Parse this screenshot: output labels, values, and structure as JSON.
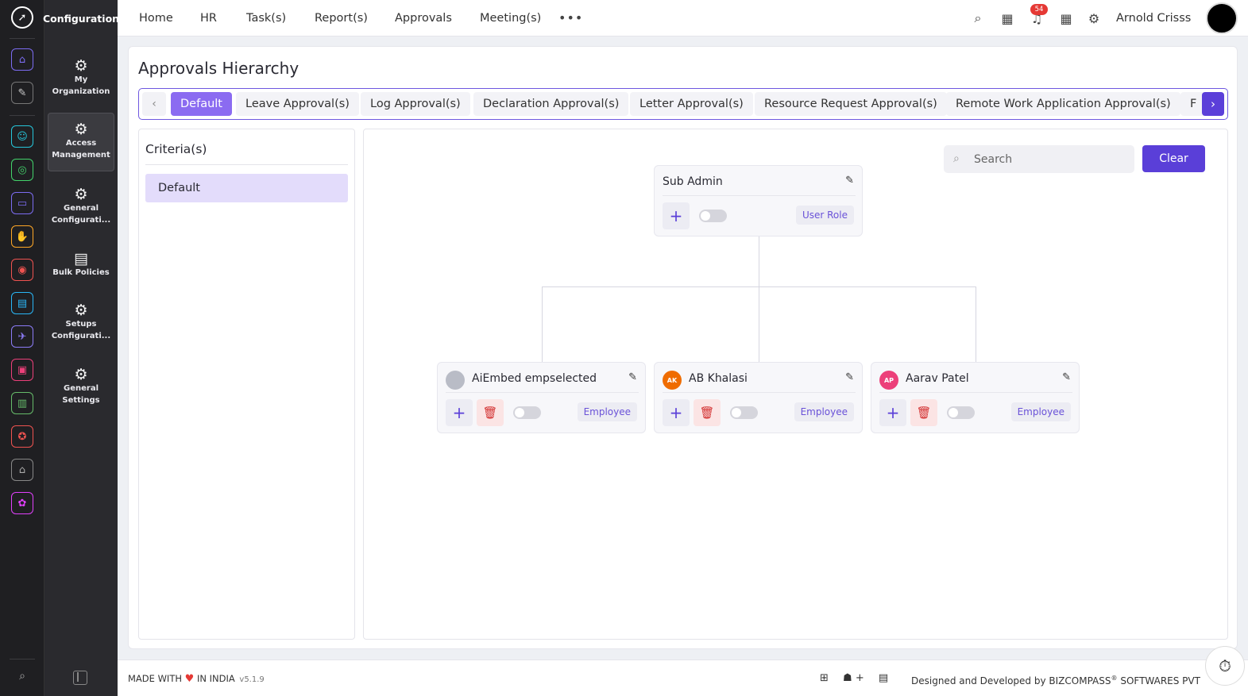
{
  "rail": {
    "icons": [
      {
        "name": "home-icon",
        "glyph": "⌂",
        "color": "#7c6cf2"
      },
      {
        "name": "pin-icon",
        "glyph": "✎",
        "color": "#cccccc"
      },
      {
        "name": "people-icon",
        "glyph": "☺",
        "color": "#26c6da"
      },
      {
        "name": "globe-icon",
        "glyph": "◎",
        "color": "#43d36b"
      },
      {
        "name": "briefcase-icon",
        "glyph": "▭",
        "color": "#7c6cf2"
      },
      {
        "name": "hands-icon",
        "glyph": "✋",
        "color": "#ffa726"
      },
      {
        "name": "target-icon",
        "glyph": "◉",
        "color": "#ef5350"
      },
      {
        "name": "calendar-icon",
        "glyph": "▤",
        "color": "#29b6f6"
      },
      {
        "name": "plane-icon",
        "glyph": "✈",
        "color": "#8c7cf7"
      },
      {
        "name": "monitor-icon",
        "glyph": "▣",
        "color": "#ec407a"
      },
      {
        "name": "document-icon",
        "glyph": "▥",
        "color": "#66bb6a"
      },
      {
        "name": "award-icon",
        "glyph": "✪",
        "color": "#ef5350"
      },
      {
        "name": "house-icon",
        "glyph": "⌂",
        "color": "#9e9e9e"
      },
      {
        "name": "settings-icon",
        "glyph": "✿",
        "color": "#e040fb"
      }
    ]
  },
  "subnav": {
    "title": "Configuration",
    "items": [
      {
        "label": "My Organization",
        "icon": "org-gear-icon"
      },
      {
        "label": "Access Management",
        "icon": "gear-icon"
      },
      {
        "label": "General Configurati...",
        "icon": "gear-icon"
      },
      {
        "label": "Bulk Policies",
        "icon": "policy-icon"
      },
      {
        "label": "Setups Configurati...",
        "icon": "gear-icon"
      },
      {
        "label": "General Settings",
        "icon": "org-gear-icon"
      }
    ]
  },
  "topnav": {
    "items": [
      "Home",
      "HR",
      "Task(s)",
      "Report(s)",
      "Approvals",
      "Meeting(s)"
    ],
    "more": "•••",
    "notifications": "54",
    "user": "Arnold Crisss"
  },
  "page": {
    "title": "Approvals Hierarchy",
    "tabs": [
      "Default",
      "Leave Approval(s)",
      "Log Approval(s)",
      "Declaration Approval(s)",
      "Letter Approval(s)",
      "Resource Request Approval(s)",
      "Remote Work Application Approval(s)",
      "F"
    ],
    "active_tab": "Default"
  },
  "criteria": {
    "title": "Criteria(s)",
    "items": [
      "Default"
    ]
  },
  "tree": {
    "search_placeholder": "Search",
    "clear_label": "Clear",
    "root": {
      "name": "Sub Admin",
      "role": "User Role",
      "toggle_on": false
    },
    "children": [
      {
        "name": "AiEmbed empselected",
        "initials": "",
        "avatar_color": "#b9bcc6",
        "role": "Employee",
        "toggle_on": false
      },
      {
        "name": "AB Khalasi",
        "initials": "AK",
        "avatar_color": "#ef6c00",
        "role": "Employee",
        "toggle_on": false
      },
      {
        "name": "Aarav Patel",
        "initials": "AP",
        "avatar_color": "#ec407a",
        "role": "Employee",
        "toggle_on": false
      }
    ]
  },
  "footer": {
    "made_with": "MADE WITH",
    "in_india": "IN INDIA",
    "version": "v5.1.9",
    "credit": "Designed and Developed by",
    "company": "BIZCOMPASS",
    "reg": "®",
    "company_suffix": "SOFTWARES PVT"
  }
}
